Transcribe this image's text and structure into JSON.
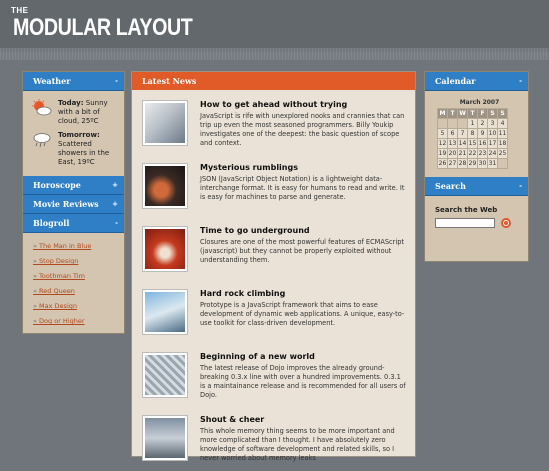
{
  "logo": {
    "the": "THE",
    "title": "MODULAR LAYOUT"
  },
  "left": {
    "weather": {
      "header": "Weather",
      "toggle": "-",
      "items": [
        {
          "icon": "sun-cloud-icon",
          "label": "Today:",
          "text": " Sunny with a bit of cloud, 25ºC"
        },
        {
          "icon": "rain-cloud-icon",
          "label": "Tomorrow:",
          "text": " Scattered showers in the East, 19ºC"
        }
      ]
    },
    "horoscope": {
      "header": "Horoscope",
      "toggle": "+"
    },
    "reviews": {
      "header": "Movie Reviews",
      "toggle": "+"
    },
    "blogroll": {
      "header": "Blogroll",
      "toggle": "-",
      "links": [
        "The Man in Blue",
        "Stop Design",
        "Toothman Tim",
        "Red Queen",
        "Max Design",
        "Dog or Higher"
      ]
    }
  },
  "center": {
    "header": "Latest News",
    "items": [
      {
        "title": "How to get ahead without trying",
        "text": "JavaScript is rife with unexplored nooks and crannies that can trip up even the most seasoned programmers. Billy Youkip investigates one of the deepest: the basic question of scope and context."
      },
      {
        "title": "Mysterious rumblings",
        "text": "JSON (JavaScript Object Notation) is a lightweight data-interchange format. It is easy for humans to read and write. It is easy for machines to parse and generate."
      },
      {
        "title": "Time to go underground",
        "text": "Closures are one of the most powerful features of ECMAScript (javascript) but they cannot be properly exploited without understanding them."
      },
      {
        "title": "Hard rock climbing",
        "text": "Prototype is a JavaScript framework that aims to ease development of dynamic web applications. A unique, easy-to-use toolkit for class-driven development."
      },
      {
        "title": "Beginning of a new world",
        "text": "The latest release of Dojo improves the already ground-breaking 0.3.x line with over a hundred improvements. 0.3.1 is a maintainance release and is recommended for all users of Dojo."
      },
      {
        "title": "Shout & cheer",
        "text": "This whole memory thing seems to be more important and more complicated than I thought. I have absolutely zero knowledge of software development and related skills, so I never worried about memory leaks"
      }
    ]
  },
  "right": {
    "calendar": {
      "header": "Calendar",
      "toggle": "-",
      "month": "March 2007",
      "days": [
        "M",
        "T",
        "W",
        "T",
        "F",
        "S",
        "S"
      ],
      "weeks": [
        [
          "",
          "",
          "",
          "1",
          "2",
          "3",
          "4"
        ],
        [
          "5",
          "6",
          "7",
          "8",
          "9",
          "10",
          "11"
        ],
        [
          "12",
          "13",
          "14",
          "15",
          "16",
          "17",
          "18"
        ],
        [
          "19",
          "20",
          "21",
          "22",
          "23",
          "24",
          "25"
        ],
        [
          "26",
          "27",
          "28",
          "29",
          "30",
          "31",
          ""
        ]
      ]
    },
    "search": {
      "header": "Search",
      "toggle": "-",
      "label": "Search the Web",
      "placeholder": "",
      "value": ""
    }
  }
}
